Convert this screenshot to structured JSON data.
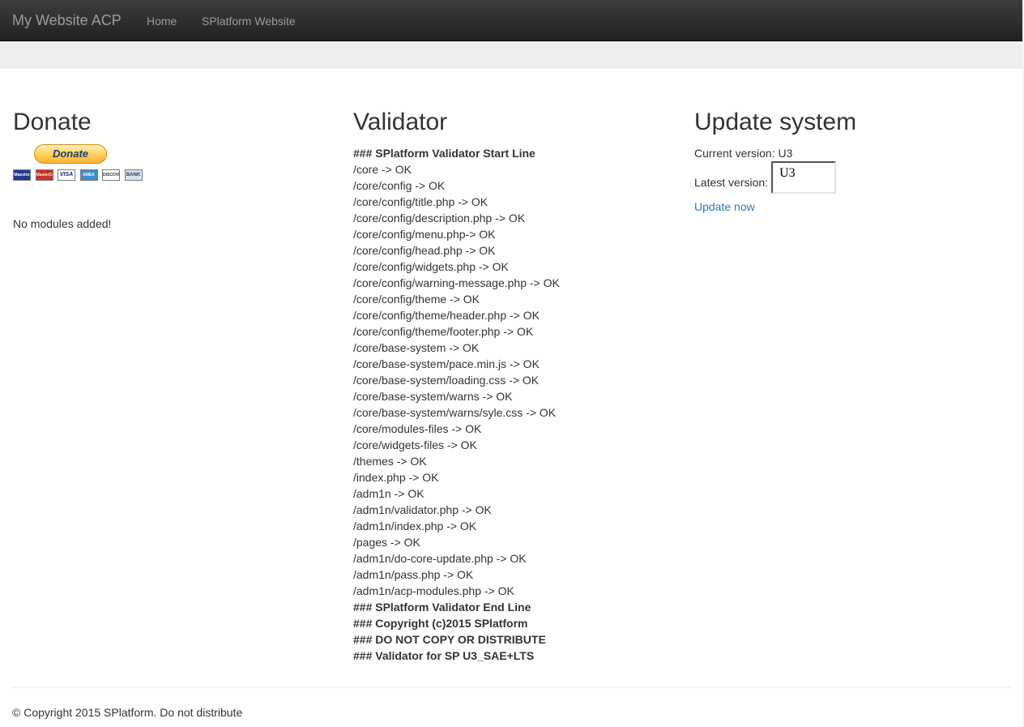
{
  "navbar": {
    "brand": "My Website ACP",
    "links": [
      {
        "label": "Home"
      },
      {
        "label": "SPlatform Website"
      }
    ]
  },
  "donate": {
    "title": "Donate",
    "button_label": "Donate",
    "cards": [
      "Maestro",
      "MasterCard",
      "VISA",
      "AMEX",
      "DISCOVER",
      "BANK"
    ],
    "modules_text": "No modules added!"
  },
  "validator": {
    "title": "Validator",
    "lines": [
      {
        "text": "### SPlatform Validator Start Line",
        "bold": true
      },
      {
        "text": "/core -> OK"
      },
      {
        "text": "/core/config -> OK"
      },
      {
        "text": "/core/config/title.php -> OK"
      },
      {
        "text": "/core/config/description.php -> OK"
      },
      {
        "text": "/core/config/menu.php-> OK"
      },
      {
        "text": "/core/config/head.php -> OK"
      },
      {
        "text": "/core/config/widgets.php -> OK"
      },
      {
        "text": "/core/config/warning-message.php -> OK"
      },
      {
        "text": "/core/config/theme -> OK"
      },
      {
        "text": "/core/config/theme/header.php -> OK"
      },
      {
        "text": "/core/config/theme/footer.php -> OK"
      },
      {
        "text": "/core/base-system -> OK"
      },
      {
        "text": "/core/base-system/pace.min.js -> OK"
      },
      {
        "text": "/core/base-system/loading.css -> OK"
      },
      {
        "text": "/core/base-system/warns -> OK"
      },
      {
        "text": "/core/base-system/warns/syle.css -> OK"
      },
      {
        "text": "/core/modules-files -> OK"
      },
      {
        "text": "/core/widgets-files -> OK"
      },
      {
        "text": "/themes -> OK"
      },
      {
        "text": "/index.php -> OK"
      },
      {
        "text": "/adm1n -> OK"
      },
      {
        "text": "/adm1n/validator.php -> OK"
      },
      {
        "text": "/adm1n/index.php -> OK"
      },
      {
        "text": "/pages -> OK"
      },
      {
        "text": "/adm1n/do-core-update.php -> OK"
      },
      {
        "text": "/adm1n/pass.php -> OK"
      },
      {
        "text": "/adm1n/acp-modules.php -> OK"
      },
      {
        "text": "### SPlatform Validator End Line",
        "bold": true
      },
      {
        "text": "### Copyright (c)2015 SPlatform",
        "bold": true
      },
      {
        "text": "### DO NOT COPY OR DISTRIBUTE",
        "bold": true
      },
      {
        "text": "### Validator for SP U3_SAE+LTS",
        "bold": true
      }
    ]
  },
  "update": {
    "title": "Update system",
    "current_version_text": "Current version: U3",
    "latest_label": "Latest version:",
    "latest_value": "U3",
    "update_link": "Update now"
  },
  "footer": {
    "text": "© Copyright 2015 SPlatform. Do not distribute"
  }
}
